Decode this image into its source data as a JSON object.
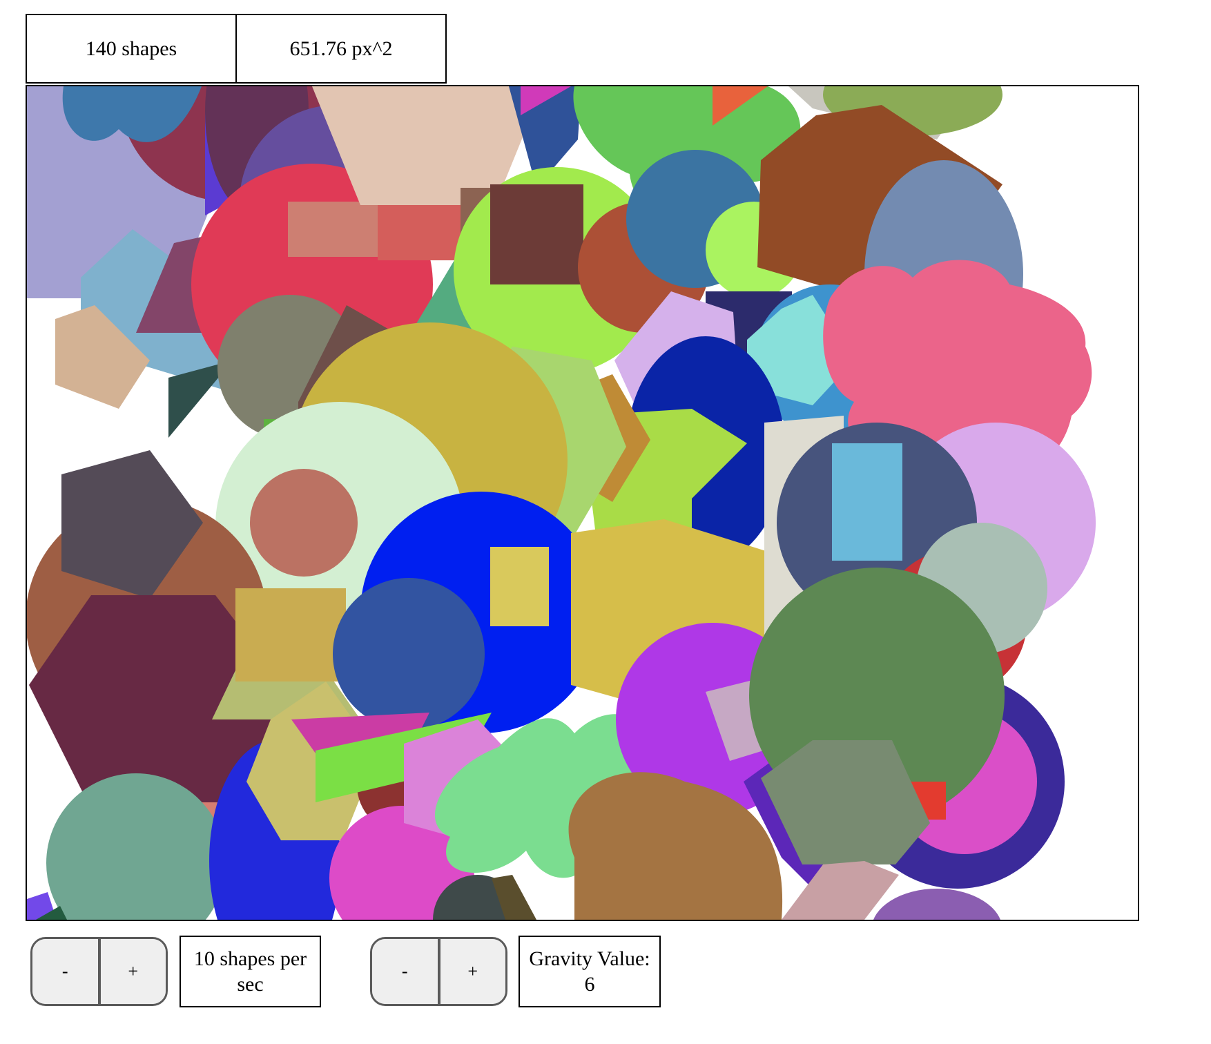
{
  "stats": {
    "shape_count_label": "140 shapes",
    "area_label": "651.76 px^2"
  },
  "controls": {
    "rate": {
      "decrease_label": "-",
      "increase_label": "+",
      "display": "10 shapes per sec"
    },
    "gravity": {
      "decrease_label": "-",
      "increase_label": "+",
      "label": "Gravity Value:",
      "value": "6"
    }
  },
  "canvas": {
    "background": "#ffffff",
    "shapes": [
      {
        "kind": "polygon",
        "color": "#a3a0d2"
      },
      {
        "kind": "circle",
        "color": "#8e344f"
      },
      {
        "kind": "cloud",
        "color": "#3e78ab"
      },
      {
        "kind": "polygon",
        "color": "#5b3bd2"
      },
      {
        "kind": "ellipse",
        "color": "#633257"
      },
      {
        "kind": "circle",
        "color": "#654e9e"
      },
      {
        "kind": "polygon",
        "color": "#7fb1cd"
      },
      {
        "kind": "polygon",
        "color": "#d3b294"
      },
      {
        "kind": "polygon",
        "color": "#834569"
      },
      {
        "kind": "circle",
        "color": "#e03a56"
      },
      {
        "kind": "polygon",
        "color": "#2f4f4b"
      },
      {
        "kind": "circle",
        "color": "#7f806d"
      },
      {
        "kind": "rect",
        "color": "#cd7f72"
      },
      {
        "kind": "rect",
        "color": "#d45e5b"
      },
      {
        "kind": "polygon",
        "color": "#e2c5b2"
      },
      {
        "kind": "polygon",
        "color": "#2f5299"
      },
      {
        "kind": "polygon",
        "color": "#d03ab9"
      },
      {
        "kind": "rect",
        "color": "#8c6352"
      },
      {
        "kind": "polygon",
        "color": "#54ab80"
      },
      {
        "kind": "circle",
        "color": "#a2ea4d"
      },
      {
        "kind": "rect",
        "color": "#6c3b37"
      },
      {
        "kind": "cloud",
        "color": "#65c658"
      },
      {
        "kind": "polygon",
        "color": "#e8623c"
      },
      {
        "kind": "circle",
        "color": "#ac5036"
      },
      {
        "kind": "circle",
        "color": "#3b74a2"
      },
      {
        "kind": "ellipse",
        "color": "#aaf360"
      },
      {
        "kind": "rect",
        "color": "#2c2b6c"
      },
      {
        "kind": "polygon",
        "color": "#c8c6be"
      },
      {
        "kind": "ellipse",
        "color": "#8bab56"
      },
      {
        "kind": "polygon",
        "color": "#924b26"
      },
      {
        "kind": "circle",
        "color": "#3e93ce"
      },
      {
        "kind": "polygon",
        "color": "#88e0da"
      },
      {
        "kind": "ellipse",
        "color": "#738bb1"
      },
      {
        "kind": "cloud",
        "color": "#eb648a"
      },
      {
        "kind": "polygon",
        "color": "#d5b1eb"
      },
      {
        "kind": "circle",
        "color": "#0a24a7"
      },
      {
        "kind": "polygon",
        "color": "#a9dc47"
      },
      {
        "kind": "polygon",
        "color": "#bf8b36"
      },
      {
        "kind": "polygon",
        "color": "#a8d66e"
      },
      {
        "kind": "polygon",
        "color": "#6e4f4a"
      },
      {
        "kind": "rect",
        "color": "#5db23f"
      },
      {
        "kind": "circle",
        "color": "#c8b341"
      },
      {
        "kind": "circle",
        "color": "#d3efd2"
      },
      {
        "kind": "circle",
        "color": "#bb7263"
      },
      {
        "kind": "circle",
        "color": "#001ff0"
      },
      {
        "kind": "rect",
        "color": "#d9c95c"
      },
      {
        "kind": "polygon",
        "color": "#d6be4a"
      },
      {
        "kind": "polygon",
        "color": "#dedcd1"
      },
      {
        "kind": "circle",
        "color": "#d9a9eb"
      },
      {
        "kind": "circle",
        "color": "#47547d"
      },
      {
        "kind": "rect",
        "color": "#6ab9da"
      },
      {
        "kind": "circle",
        "color": "#c73236"
      },
      {
        "kind": "circle",
        "color": "#a9bfb4"
      },
      {
        "kind": "circle",
        "color": "#9e5e44"
      },
      {
        "kind": "polygon",
        "color": "#544b57"
      },
      {
        "kind": "polygon",
        "color": "#672944"
      },
      {
        "kind": "rect",
        "color": "#d67e71"
      },
      {
        "kind": "circle",
        "color": "#70a692"
      },
      {
        "kind": "polygon",
        "color": "#b5bd72"
      },
      {
        "kind": "rect",
        "color": "#c9ac51"
      },
      {
        "kind": "circle",
        "color": "#3254a1"
      },
      {
        "kind": "ellipse",
        "color": "#2229dc"
      },
      {
        "kind": "polygon",
        "color": "#c9c06d"
      },
      {
        "kind": "circle",
        "color": "#8c3230"
      },
      {
        "kind": "circle",
        "color": "#dd4bc8"
      },
      {
        "kind": "polygon",
        "color": "#cb3ca4"
      },
      {
        "kind": "polygon",
        "color": "#7bdf45"
      },
      {
        "kind": "polygon",
        "color": "#db83d9"
      },
      {
        "kind": "cloud",
        "color": "#7bdd90"
      },
      {
        "kind": "circle",
        "color": "#af38e7"
      },
      {
        "kind": "polygon",
        "color": "#c6a8c4"
      },
      {
        "kind": "ellipse",
        "color": "#a47442"
      },
      {
        "kind": "polygon",
        "color": "#5c27b8"
      },
      {
        "kind": "circle",
        "color": "#3b2a9a"
      },
      {
        "kind": "circle",
        "color": "#da4fc8"
      },
      {
        "kind": "circle",
        "color": "#5d8853"
      },
      {
        "kind": "rect",
        "color": "#e33b2f"
      },
      {
        "kind": "polygon",
        "color": "#788b71"
      },
      {
        "kind": "polygon",
        "color": "#c8a0a4"
      },
      {
        "kind": "ellipse",
        "color": "#8b5eb1"
      },
      {
        "kind": "circle",
        "color": "#3f4a4a"
      },
      {
        "kind": "polygon",
        "color": "#5a4e2d"
      },
      {
        "kind": "polygon",
        "color": "#7249e9"
      },
      {
        "kind": "polygon",
        "color": "#235b3f"
      }
    ]
  }
}
